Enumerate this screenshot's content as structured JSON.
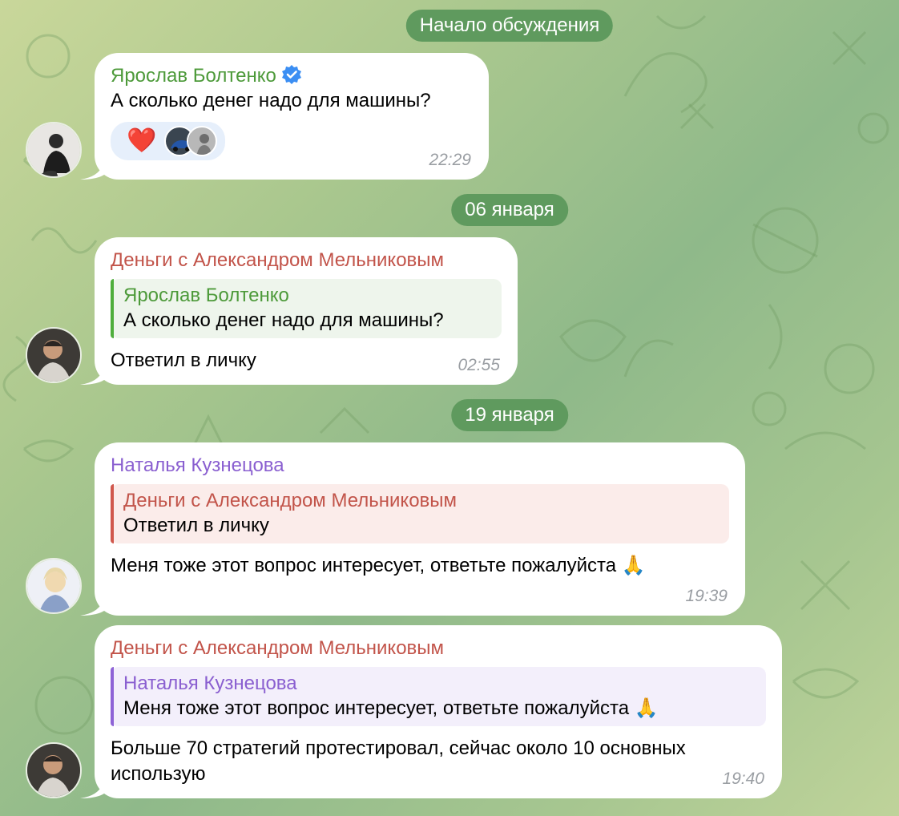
{
  "date_pills": {
    "start": "Начало обсуждения",
    "jan6": "06 января",
    "jan19": "19 января"
  },
  "colors": {
    "green_name": "#4d9a3a",
    "red_name": "#c2544a",
    "purple_name": "#8a5fd0",
    "pill_bg": "#5f9a5e",
    "verified": "#3b8ef3"
  },
  "messages": [
    {
      "sender": "Ярослав Болтенко",
      "verified": true,
      "text": "А сколько денег надо для машины?",
      "reaction": "❤️",
      "time": "22:29"
    },
    {
      "sender": "Деньги с Александром Мельниковым",
      "reply_to": {
        "name": "Ярослав Болтенко",
        "text": "А сколько денег надо для машины?"
      },
      "text": "Ответил в личку",
      "time": "02:55"
    },
    {
      "sender": "Наталья Кузнецова",
      "reply_to": {
        "name": "Деньги с Александром Мельниковым",
        "text": "Ответил в личку"
      },
      "text": "Меня тоже этот вопрос интересует, ответьте пожалуйста 🙏",
      "time": "19:39"
    },
    {
      "sender": "Деньги с Александром Мельниковым",
      "reply_to": {
        "name": "Наталья Кузнецова",
        "text": "Меня тоже этот вопрос интересует, ответьте пожалуйста 🙏"
      },
      "text": "Больше 70 стратегий протестировал, сейчас около 10 основных использую",
      "time": "19:40"
    }
  ]
}
